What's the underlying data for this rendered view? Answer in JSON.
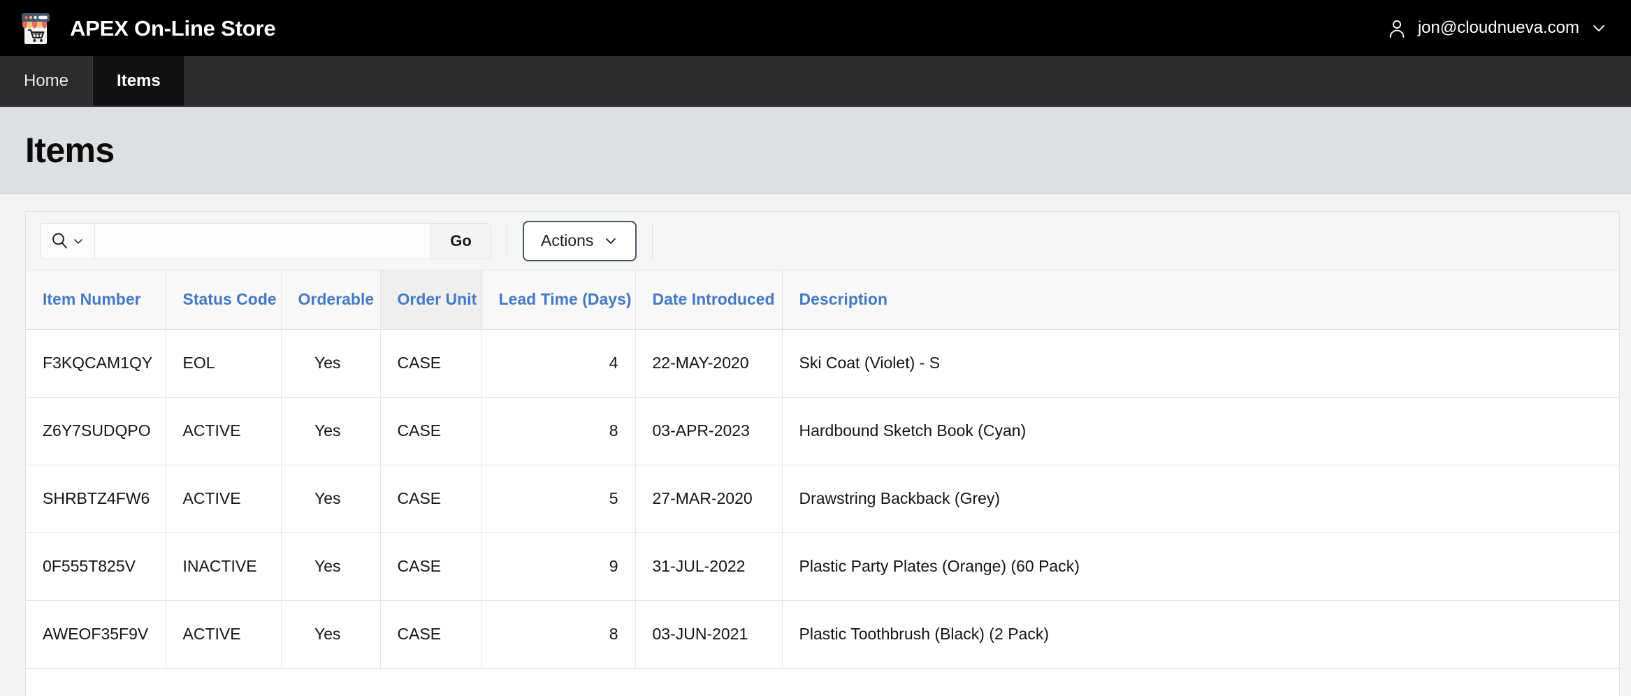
{
  "header": {
    "logo_icon": "storefront-shop-icon",
    "app_title": "APEX On-Line Store",
    "user_icon": "person-icon",
    "user_email": "jon@cloudnueva.com",
    "user_chevron_icon": "chevron-down-icon"
  },
  "tabs": [
    {
      "label": "Home",
      "active": false
    },
    {
      "label": "Items",
      "active": true
    }
  ],
  "page": {
    "title": "Items"
  },
  "toolbar": {
    "search_icon": "search-icon",
    "search_chevron_icon": "chevron-down-icon",
    "search_value": "",
    "search_placeholder": "",
    "go_label": "Go",
    "actions_label": "Actions",
    "actions_chevron_icon": "chevron-down-icon"
  },
  "colors": {
    "header_bg": "#000000",
    "tab_bg": "#2b2b2b",
    "tab_active_bg": "#111111",
    "title_band_bg": "#dedfe2",
    "page_bg": "#f4f4f4",
    "column_header_link": "#4579c4",
    "actions_border": "#4a5568",
    "highlight_column_bg": "#efefef"
  },
  "table": {
    "columns": [
      {
        "label": "Item Number",
        "align": "left",
        "highlight": false
      },
      {
        "label": "Status Code",
        "align": "left",
        "highlight": false
      },
      {
        "label": "Orderable",
        "align": "left",
        "highlight": false
      },
      {
        "label": "Order Unit",
        "align": "left",
        "highlight": true
      },
      {
        "label": "Lead Time (Days)",
        "align": "right",
        "highlight": false
      },
      {
        "label": "Date Introduced",
        "align": "left",
        "highlight": false
      },
      {
        "label": "Description",
        "align": "left",
        "highlight": false
      }
    ],
    "rows": [
      {
        "item_number": "F3KQCAM1QY",
        "status_code": "EOL",
        "orderable": "Yes",
        "order_unit": "CASE",
        "lead_time_days": "4",
        "date_introduced": "22-MAY-2020",
        "description": "Ski Coat (Violet) - S"
      },
      {
        "item_number": "Z6Y7SUDQPO",
        "status_code": "ACTIVE",
        "orderable": "Yes",
        "order_unit": "CASE",
        "lead_time_days": "8",
        "date_introduced": "03-APR-2023",
        "description": "Hardbound Sketch Book (Cyan)"
      },
      {
        "item_number": "SHRBTZ4FW6",
        "status_code": "ACTIVE",
        "orderable": "Yes",
        "order_unit": "CASE",
        "lead_time_days": "5",
        "date_introduced": "27-MAR-2020",
        "description": "Drawstring Backback (Grey)"
      },
      {
        "item_number": "0F555T825V",
        "status_code": "INACTIVE",
        "orderable": "Yes",
        "order_unit": "CASE",
        "lead_time_days": "9",
        "date_introduced": "31-JUL-2022",
        "description": "Plastic Party Plates (Orange) (60 Pack)"
      },
      {
        "item_number": "AWEOF35F9V",
        "status_code": "ACTIVE",
        "orderable": "Yes",
        "order_unit": "CASE",
        "lead_time_days": "8",
        "date_introduced": "03-JUN-2021",
        "description": "Plastic Toothbrush (Black) (2 Pack)"
      }
    ]
  }
}
